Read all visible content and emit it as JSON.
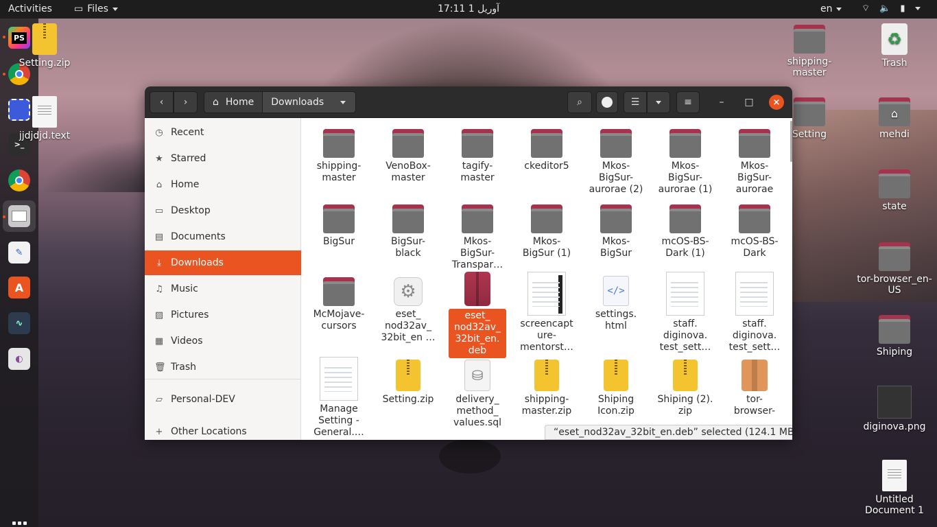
{
  "topbar": {
    "activities": "Activities",
    "app_menu": "Files",
    "clock": "آوریل 1  17:11",
    "language": "en"
  },
  "desktop": {
    "left_icons": [
      {
        "label": "Setting.zip",
        "type": "zip"
      },
      {
        "label": "jjdjdjd.text",
        "type": "doc"
      }
    ],
    "right_icons": [
      {
        "label": "shipping-master",
        "type": "folder"
      },
      {
        "label": "Trash",
        "type": "trash"
      },
      {
        "label": "Setting",
        "type": "folder"
      },
      {
        "label": "mehdi",
        "type": "home"
      },
      {
        "label": "state",
        "type": "folder"
      },
      {
        "label": "tor-browser_en-US",
        "type": "folder"
      },
      {
        "label": "Shiping",
        "type": "folder"
      },
      {
        "label": "diginova.png",
        "type": "image"
      },
      {
        "label": "Untitled Document 1",
        "type": "doc"
      }
    ]
  },
  "window": {
    "path": [
      "Home",
      "Downloads"
    ],
    "sidebar": [
      {
        "label": "Recent",
        "icon": "clock-icon",
        "glyph": "◷"
      },
      {
        "label": "Starred",
        "icon": "star-icon",
        "glyph": "★"
      },
      {
        "label": "Home",
        "icon": "home-icon",
        "glyph": "⌂"
      },
      {
        "label": "Desktop",
        "icon": "desktop-icon",
        "glyph": "▭"
      },
      {
        "label": "Documents",
        "icon": "documents-icon",
        "glyph": "▤"
      },
      {
        "label": "Downloads",
        "icon": "download-icon",
        "glyph": "⤓"
      },
      {
        "label": "Music",
        "icon": "music-icon",
        "glyph": "♫"
      },
      {
        "label": "Pictures",
        "icon": "pictures-icon",
        "glyph": "▨"
      },
      {
        "label": "Videos",
        "icon": "videos-icon",
        "glyph": "▦"
      },
      {
        "label": "Trash",
        "icon": "trash-icon",
        "glyph": "🗑"
      },
      {
        "label": "Personal-DEV",
        "icon": "folder-icon",
        "glyph": "▱"
      },
      {
        "label": "Other Locations",
        "icon": "plus-icon",
        "glyph": "+"
      }
    ],
    "files": [
      {
        "label": "shipping-\nmaster",
        "type": "folder"
      },
      {
        "label": "VenoBox-\nmaster",
        "type": "folder"
      },
      {
        "label": "tagify-\nmaster",
        "type": "folder"
      },
      {
        "label": "ckeditor5",
        "type": "folder"
      },
      {
        "label": "Mkos-\nBigSur-\naurorae (2)",
        "type": "folder"
      },
      {
        "label": "Mkos-\nBigSur-\naurorae (1)",
        "type": "folder"
      },
      {
        "label": "Mkos-\nBigSur-\naurorae",
        "type": "folder"
      },
      {
        "label": "BigSur",
        "type": "folder"
      },
      {
        "label": "BigSur-\nblack",
        "type": "folder"
      },
      {
        "label": "Mkos-\nBigSur-\nTranspar…",
        "type": "folder"
      },
      {
        "label": "Mkos-\nBigSur (1)",
        "type": "folder"
      },
      {
        "label": "Mkos-\nBigSur",
        "type": "folder"
      },
      {
        "label": "mcOS-BS-\nDark (1)",
        "type": "folder"
      },
      {
        "label": "mcOS-BS-\nDark",
        "type": "folder"
      },
      {
        "label": "McMojave-\ncursors",
        "type": "folder"
      },
      {
        "label": "eset_\nnod32av_\n32bit_en …",
        "type": "gear"
      },
      {
        "label": "eset_\nnod32av_\n32bit_en.\ndeb",
        "type": "deb",
        "selected": true
      },
      {
        "label": "screencapt\nure-\nmentorst…",
        "type": "thumb-dark"
      },
      {
        "label": "settings.\nhtml",
        "type": "html"
      },
      {
        "label": "staff.\ndiginova.\ntest_sett…",
        "type": "thumb"
      },
      {
        "label": "staff.\ndiginova.\ntest_sett…",
        "type": "thumb"
      },
      {
        "label": "Manage\nSetting -\nGeneral.…",
        "type": "thumb"
      },
      {
        "label": "Setting.zip",
        "type": "zip"
      },
      {
        "label": "delivery_\nmethod_\nvalues.sql",
        "type": "db"
      },
      {
        "label": "shipping-\nmaster.zip",
        "type": "zip"
      },
      {
        "label": "Shiping\nIcon.zip",
        "type": "zip"
      },
      {
        "label": "Shiping (2).\nzip",
        "type": "zip"
      },
      {
        "label": "tor-\nbrowser-",
        "type": "pkg"
      }
    ],
    "status": "“eset_nod32av_32bit_en.deb” selected  (124.1 MB)"
  },
  "colors": {
    "accent": "#e95420",
    "folder_tab": "#a6334d",
    "folder_body": "#717171"
  }
}
